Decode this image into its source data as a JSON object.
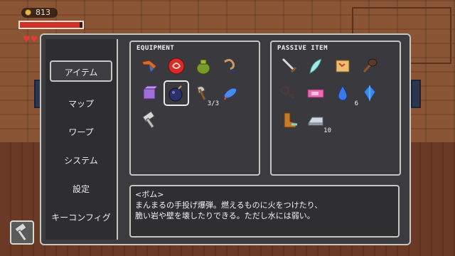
{
  "hud": {
    "coins": "813",
    "hp_fraction": 0.95,
    "hearts": "♥♥"
  },
  "menu": {
    "side_items": [
      "アイテム",
      "マップ",
      "ワープ",
      "システム",
      "設定",
      "キーコンフィグ"
    ],
    "active_index": 0,
    "equipment_title": "EQUIPMENT",
    "passive_title": "PASSIVE ITEM",
    "equipment": [
      {
        "icon": "boomerang-icon",
        "count": ""
      },
      {
        "icon": "fire-rune-icon",
        "count": ""
      },
      {
        "icon": "seed-bag-icon",
        "count": ""
      },
      {
        "icon": "grapple-hook-icon",
        "count": ""
      },
      {
        "icon": "magic-cube-icon",
        "count": ""
      },
      {
        "icon": "bomb-icon",
        "count": "",
        "selected": true
      },
      {
        "icon": "axe-icon",
        "count": "3/3"
      },
      {
        "icon": "fish-icon",
        "count": ""
      },
      {
        "icon": "hammer-icon",
        "count": ""
      }
    ],
    "passive": [
      {
        "icon": "sword-icon",
        "count": ""
      },
      {
        "icon": "feather-icon",
        "count": ""
      },
      {
        "icon": "map-scroll-icon",
        "count": ""
      },
      {
        "icon": "shovel-icon",
        "count": ""
      },
      {
        "icon": "key-icon",
        "count": ""
      },
      {
        "icon": "ticket-icon",
        "count": ""
      },
      {
        "icon": "water-drop-icon",
        "count": "6"
      },
      {
        "icon": "blue-gem-icon",
        "count": ""
      },
      {
        "icon": "boots-icon",
        "count": ""
      },
      {
        "icon": "silver-ingot-icon",
        "count": "10"
      }
    ],
    "description": {
      "name": "<ボム>",
      "line1": "まんまるの手投げ爆弾。燃えるものに火をつけたり、",
      "line2": "脆い岩や壁を壊したりできる。ただし水には弱い。"
    }
  },
  "colors": {
    "panel_bg": "#3a3a3e",
    "border": "#c6c6c0",
    "hp_red": "#d0302a"
  }
}
